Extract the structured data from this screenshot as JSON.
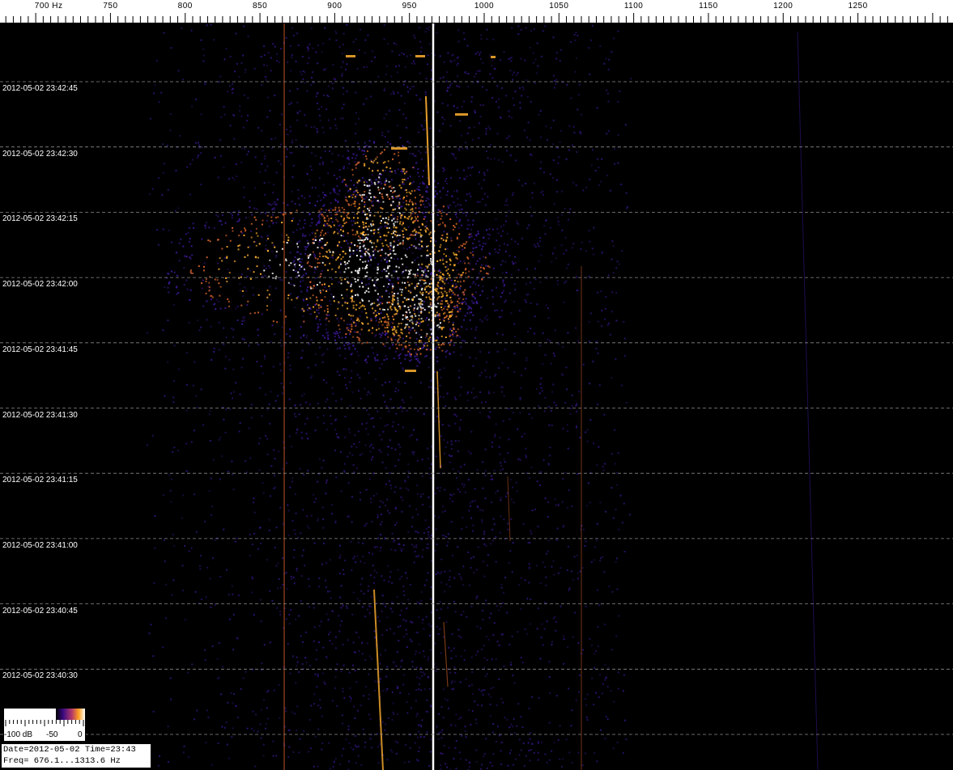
{
  "ruler": {
    "unit": "Hz",
    "labels": [
      "700 Hz",
      "750",
      "800",
      "850",
      "900",
      "950",
      "1000",
      "1050",
      "1100",
      "1150",
      "1200",
      "1250"
    ],
    "label_freqs": [
      700,
      750,
      800,
      850,
      900,
      950,
      1000,
      1050,
      1100,
      1150,
      1200,
      1250
    ]
  },
  "freq_range": {
    "start": 676.1,
    "end": 1313.6
  },
  "time_labels": [
    "2012-05-02 23:42:45",
    "2012-05-02 23:42:30",
    "2012-05-02 23:42:15",
    "2012-05-02 23:42:00",
    "2012-05-02 23:41:45",
    "2012-05-02 23:41:30",
    "2012-05-02 23:41:15",
    "2012-05-02 23:41:00",
    "2012-05-02 23:40:45",
    "2012-05-02 23:40:30"
  ],
  "colorbar": {
    "labels": [
      "-100 dB",
      "-50",
      "0"
    ]
  },
  "info": {
    "line1": "Date=2012-05-02 Time=23:43",
    "line2": "Freq= 676.1...1313.6 Hz"
  },
  "colors": {
    "background": "#000000",
    "grid": "#8a8a8a",
    "carrier": "#ffffff",
    "hot": "#ffb030",
    "warm": "#d0602a",
    "cool": "#3c1a9a"
  }
}
